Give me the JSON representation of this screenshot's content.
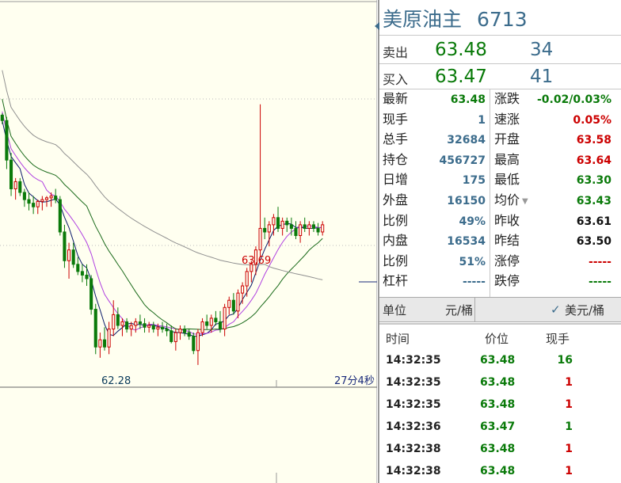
{
  "chart": {
    "high_label": "63.69",
    "low_label": "62.28",
    "time_label": "27分4秒"
  },
  "chart_data": {
    "type": "candlestick",
    "candles": [
      {
        "o": 63.63,
        "h": 63.64,
        "l": 63.58,
        "c": 63.6
      },
      {
        "o": 63.6,
        "h": 63.62,
        "l": 63.33,
        "c": 63.38
      },
      {
        "o": 63.38,
        "h": 63.42,
        "l": 63.18,
        "c": 63.22
      },
      {
        "o": 63.22,
        "h": 63.28,
        "l": 63.16,
        "c": 63.26
      },
      {
        "o": 63.26,
        "h": 63.28,
        "l": 63.18,
        "c": 63.2
      },
      {
        "o": 63.2,
        "h": 63.22,
        "l": 63.12,
        "c": 63.16
      },
      {
        "o": 63.16,
        "h": 63.2,
        "l": 63.1,
        "c": 63.14
      },
      {
        "o": 63.14,
        "h": 63.18,
        "l": 63.08,
        "c": 63.12
      },
      {
        "o": 63.12,
        "h": 63.16,
        "l": 63.08,
        "c": 63.15
      },
      {
        "o": 63.15,
        "h": 63.18,
        "l": 63.1,
        "c": 63.16
      },
      {
        "o": 63.16,
        "h": 63.18,
        "l": 63.12,
        "c": 63.17
      },
      {
        "o": 63.17,
        "h": 63.2,
        "l": 63.12,
        "c": 63.18
      },
      {
        "o": 63.18,
        "h": 63.22,
        "l": 63.14,
        "c": 63.16
      },
      {
        "o": 63.16,
        "h": 63.18,
        "l": 62.96,
        "c": 62.98
      },
      {
        "o": 62.98,
        "h": 63.02,
        "l": 62.78,
        "c": 62.82
      },
      {
        "o": 62.82,
        "h": 62.92,
        "l": 62.72,
        "c": 62.88
      },
      {
        "o": 62.88,
        "h": 62.92,
        "l": 62.78,
        "c": 62.8
      },
      {
        "o": 62.8,
        "h": 62.84,
        "l": 62.74,
        "c": 62.76
      },
      {
        "o": 62.76,
        "h": 62.8,
        "l": 62.7,
        "c": 62.74
      },
      {
        "o": 62.74,
        "h": 62.8,
        "l": 62.68,
        "c": 62.72
      },
      {
        "o": 62.72,
        "h": 62.74,
        "l": 62.52,
        "c": 62.55
      },
      {
        "o": 62.55,
        "h": 62.58,
        "l": 62.3,
        "c": 62.34
      },
      {
        "o": 62.34,
        "h": 62.42,
        "l": 62.28,
        "c": 62.38
      },
      {
        "o": 62.38,
        "h": 62.45,
        "l": 62.32,
        "c": 62.34
      },
      {
        "o": 62.34,
        "h": 62.48,
        "l": 62.3,
        "c": 62.44
      },
      {
        "o": 62.44,
        "h": 62.6,
        "l": 62.4,
        "c": 62.52
      },
      {
        "o": 62.52,
        "h": 62.56,
        "l": 62.44,
        "c": 62.46
      },
      {
        "o": 62.46,
        "h": 62.5,
        "l": 62.4,
        "c": 62.48
      },
      {
        "o": 62.48,
        "h": 62.5,
        "l": 62.42,
        "c": 62.44
      },
      {
        "o": 62.44,
        "h": 62.48,
        "l": 62.4,
        "c": 62.46
      },
      {
        "o": 62.46,
        "h": 62.5,
        "l": 62.42,
        "c": 62.48
      },
      {
        "o": 62.48,
        "h": 62.52,
        "l": 62.44,
        "c": 62.47
      },
      {
        "o": 62.47,
        "h": 62.5,
        "l": 62.42,
        "c": 62.45
      },
      {
        "o": 62.45,
        "h": 62.48,
        "l": 62.42,
        "c": 62.46
      },
      {
        "o": 62.46,
        "h": 62.48,
        "l": 62.42,
        "c": 62.44
      },
      {
        "o": 62.44,
        "h": 62.47,
        "l": 62.4,
        "c": 62.45
      },
      {
        "o": 62.45,
        "h": 62.48,
        "l": 62.42,
        "c": 62.44
      },
      {
        "o": 62.44,
        "h": 62.47,
        "l": 62.4,
        "c": 62.43
      },
      {
        "o": 62.43,
        "h": 62.46,
        "l": 62.36,
        "c": 62.37
      },
      {
        "o": 62.37,
        "h": 62.44,
        "l": 62.32,
        "c": 62.42
      },
      {
        "o": 62.42,
        "h": 62.46,
        "l": 62.38,
        "c": 62.44
      },
      {
        "o": 62.44,
        "h": 62.46,
        "l": 62.4,
        "c": 62.42
      },
      {
        "o": 62.42,
        "h": 62.44,
        "l": 62.38,
        "c": 62.4
      },
      {
        "o": 62.4,
        "h": 62.42,
        "l": 62.3,
        "c": 62.32
      },
      {
        "o": 62.32,
        "h": 62.44,
        "l": 62.24,
        "c": 62.42
      },
      {
        "o": 62.42,
        "h": 62.5,
        "l": 62.4,
        "c": 62.48
      },
      {
        "o": 62.48,
        "h": 62.52,
        "l": 62.44,
        "c": 62.46
      },
      {
        "o": 62.46,
        "h": 62.52,
        "l": 62.42,
        "c": 62.5
      },
      {
        "o": 62.5,
        "h": 62.54,
        "l": 62.46,
        "c": 62.48
      },
      {
        "o": 62.48,
        "h": 62.54,
        "l": 62.42,
        "c": 62.44
      },
      {
        "o": 62.44,
        "h": 62.58,
        "l": 62.4,
        "c": 62.56
      },
      {
        "o": 62.56,
        "h": 62.62,
        "l": 62.52,
        "c": 62.6
      },
      {
        "o": 62.6,
        "h": 62.64,
        "l": 62.52,
        "c": 62.54
      },
      {
        "o": 62.54,
        "h": 62.66,
        "l": 62.5,
        "c": 62.64
      },
      {
        "o": 62.64,
        "h": 62.7,
        "l": 62.58,
        "c": 62.68
      },
      {
        "o": 62.68,
        "h": 62.78,
        "l": 62.62,
        "c": 62.76
      },
      {
        "o": 62.76,
        "h": 62.82,
        "l": 62.7,
        "c": 62.8
      },
      {
        "o": 62.8,
        "h": 62.9,
        "l": 62.74,
        "c": 62.88
      },
      {
        "o": 62.88,
        "h": 63.69,
        "l": 62.84,
        "c": 63.0
      },
      {
        "o": 63.0,
        "h": 63.06,
        "l": 62.94,
        "c": 62.98
      },
      {
        "o": 62.98,
        "h": 63.04,
        "l": 62.9,
        "c": 63.02
      },
      {
        "o": 63.02,
        "h": 63.08,
        "l": 62.96,
        "c": 63.06
      },
      {
        "o": 63.06,
        "h": 63.12,
        "l": 62.98,
        "c": 63.0
      },
      {
        "o": 63.0,
        "h": 63.06,
        "l": 62.96,
        "c": 63.04
      },
      {
        "o": 63.04,
        "h": 63.06,
        "l": 62.98,
        "c": 63.02
      },
      {
        "o": 63.02,
        "h": 63.06,
        "l": 62.96,
        "c": 63.0
      },
      {
        "o": 63.0,
        "h": 63.04,
        "l": 62.94,
        "c": 62.96
      },
      {
        "o": 62.96,
        "h": 63.04,
        "l": 62.92,
        "c": 63.02
      },
      {
        "o": 63.02,
        "h": 63.06,
        "l": 62.98,
        "c": 63.0
      },
      {
        "o": 63.0,
        "h": 63.04,
        "l": 62.96,
        "c": 63.02
      },
      {
        "o": 63.02,
        "h": 63.04,
        "l": 62.98,
        "c": 63.0
      },
      {
        "o": 63.0,
        "h": 63.03,
        "l": 62.96,
        "c": 62.98
      },
      {
        "o": 62.98,
        "h": 63.04,
        "l": 62.96,
        "c": 63.02
      }
    ]
  },
  "quote": {
    "name": "美原油主",
    "code": "6713",
    "sell_label": "卖出",
    "sell_price": "63.48",
    "sell_vol": "34",
    "buy_label": "买入",
    "buy_price": "63.47",
    "buy_vol": "41",
    "left": [
      {
        "label": "最新",
        "value": "63.48",
        "color": "#0a7a0a"
      },
      {
        "label": "现手",
        "value": "1",
        "color": "#3c6c8c"
      },
      {
        "label": "总手",
        "value": "32684",
        "color": "#3c6c8c"
      },
      {
        "label": "持仓",
        "value": "456727",
        "color": "#3c6c8c"
      },
      {
        "label": "日增",
        "value": "175",
        "color": "#3c6c8c"
      },
      {
        "label": "外盘",
        "value": "16150",
        "color": "#3c6c8c"
      },
      {
        "label": "比例",
        "value": "49%",
        "color": "#3c6c8c"
      },
      {
        "label": "内盘",
        "value": "16534",
        "color": "#3c6c8c"
      },
      {
        "label": "比例",
        "value": "51%",
        "color": "#3c6c8c"
      },
      {
        "label": "杠杆",
        "value": "-----",
        "color": "#3c6c8c"
      }
    ],
    "right": [
      {
        "label": "涨跌",
        "value": "-0.02/0.03%",
        "color": "#0a7a0a"
      },
      {
        "label": "速涨",
        "value": "0.05%",
        "color": "#cc0000"
      },
      {
        "label": "开盘",
        "value": "63.58",
        "color": "#cc0000"
      },
      {
        "label": "最高",
        "value": "63.64",
        "color": "#cc0000"
      },
      {
        "label": "最低",
        "value": "63.30",
        "color": "#0a7a0a"
      },
      {
        "label": "均价",
        "value": "63.43",
        "color": "#0a7a0a"
      },
      {
        "label": "昨收",
        "value": "63.61",
        "color": "#111111"
      },
      {
        "label": "昨结",
        "value": "63.50",
        "color": "#111111"
      },
      {
        "label": "涨停",
        "value": "-----",
        "color": "#cc0000"
      },
      {
        "label": "跌停",
        "value": "-----",
        "color": "#0a7a0a"
      }
    ],
    "unit_label": "单位",
    "unit_value": "元/桶",
    "currency": "美元/桶"
  },
  "trades": {
    "headers": {
      "time": "时间",
      "price": "价位",
      "vol": "现手"
    },
    "rows": [
      {
        "time": "14:32:35",
        "price": "63.48",
        "vol": "16",
        "color": "#0a7a0a"
      },
      {
        "time": "14:32:35",
        "price": "63.48",
        "vol": "1",
        "color": "#cc0000"
      },
      {
        "time": "14:32:35",
        "price": "63.48",
        "vol": "1",
        "color": "#cc0000"
      },
      {
        "time": "14:32:36",
        "price": "63.47",
        "vol": "1",
        "color": "#0a7a0a"
      },
      {
        "time": "14:32:38",
        "price": "63.48",
        "vol": "1",
        "color": "#cc0000"
      },
      {
        "time": "14:32:38",
        "price": "63.48",
        "vol": "1",
        "color": "#cc0000"
      }
    ]
  },
  "colors": {
    "up": "#cc0000",
    "down": "#0a7a0a",
    "ma5": "#0a1a6a",
    "ma10": "#b040e0",
    "ma20": "#1a6a1a",
    "ma60": "#909090"
  }
}
